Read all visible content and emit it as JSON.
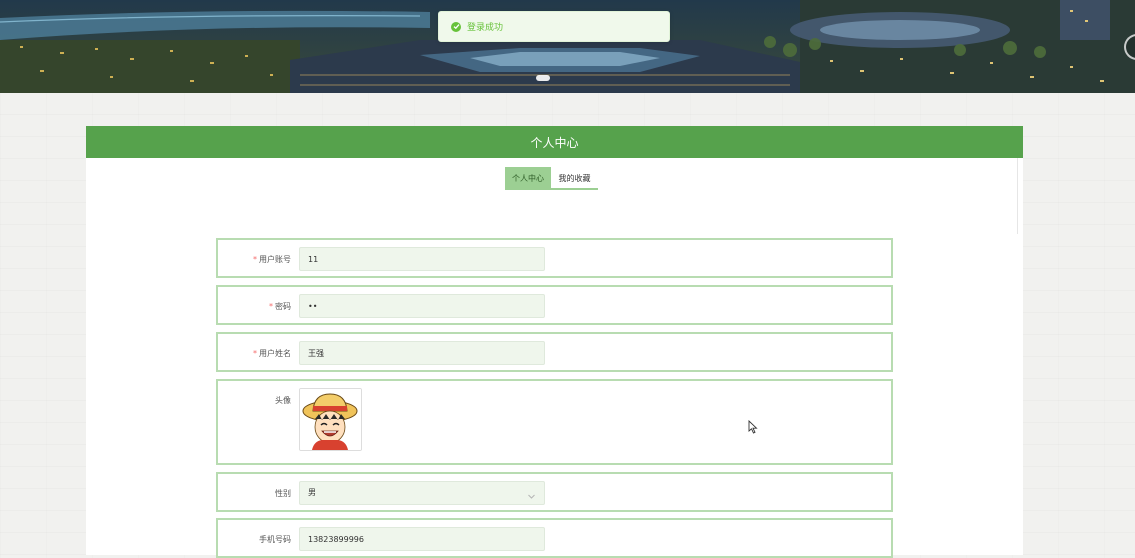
{
  "toast": {
    "message": "登录成功",
    "icon": "check-circle-icon",
    "color": "#67c23a"
  },
  "panel": {
    "title": "个人中心"
  },
  "tabs": [
    {
      "label": "个人中心",
      "active": true
    },
    {
      "label": "我的收藏",
      "active": false
    }
  ],
  "form": {
    "username": {
      "label": "用户账号",
      "required": true,
      "value": "11"
    },
    "password": {
      "label": "密码",
      "required": true,
      "value": "••"
    },
    "realname": {
      "label": "用户姓名",
      "required": true,
      "value": "王强"
    },
    "avatar": {
      "label": "头像"
    },
    "gender": {
      "label": "性别",
      "value": "男",
      "icon": "chevron-down-icon"
    },
    "phone": {
      "label": "手机号码",
      "value": "13823899996"
    }
  },
  "colors": {
    "accent": "#56a24c",
    "tab_active": "#9ccf93",
    "row_border": "#b8dcb1",
    "required": "#f56c6c"
  }
}
